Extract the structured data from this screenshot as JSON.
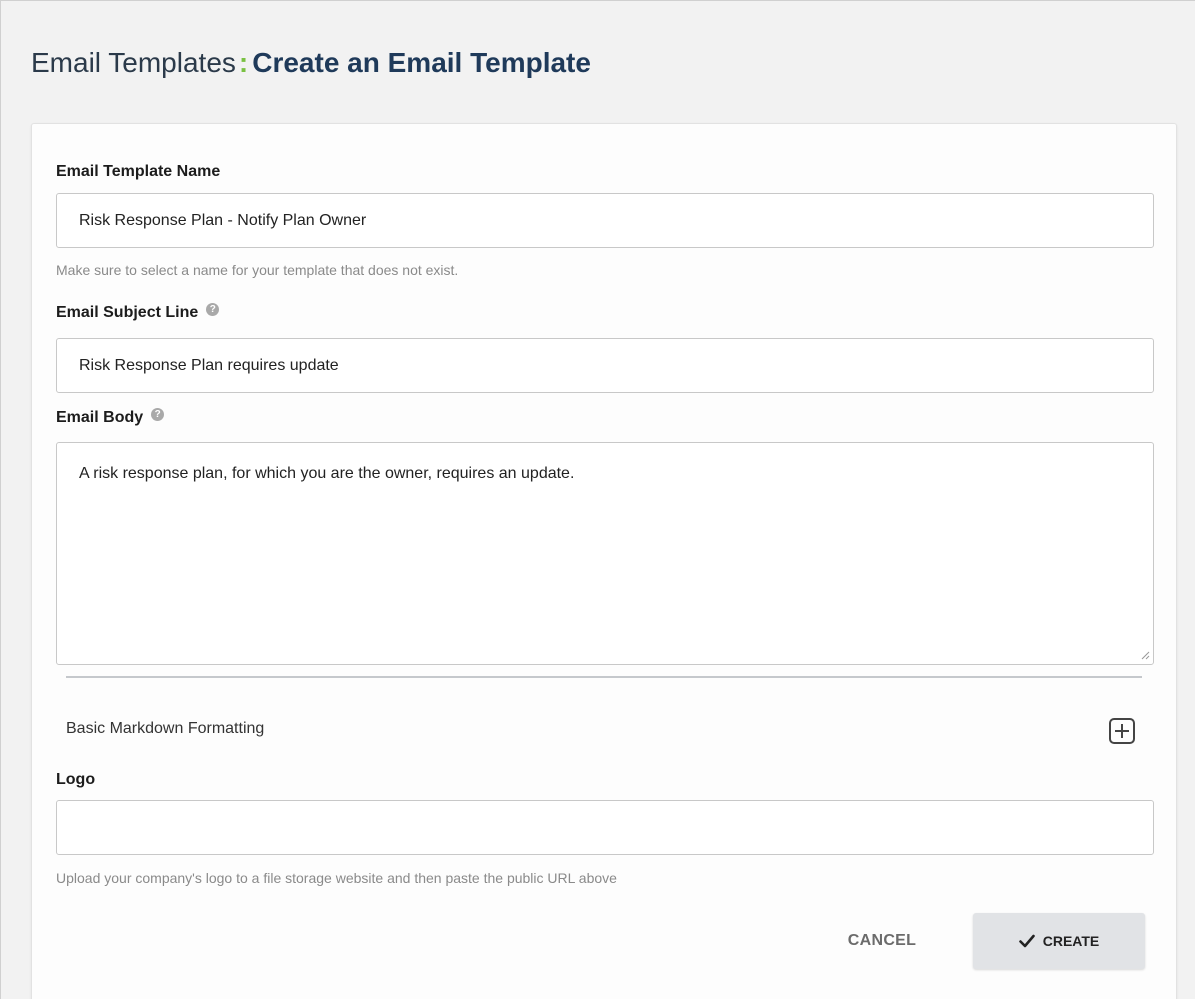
{
  "header": {
    "section": "Email Templates",
    "separator": ":",
    "page_title": "Create an Email Template"
  },
  "form": {
    "template_name": {
      "label": "Email Template Name",
      "value": "Risk Response Plan - Notify Plan Owner",
      "hint": "Make sure to select a name for your template that does not exist."
    },
    "subject_line": {
      "label": "Email Subject Line",
      "value": "Risk Response Plan requires update",
      "help_icon": "question-circle-icon"
    },
    "body": {
      "label": "Email Body",
      "value": "A risk response plan, for which you are the owner, requires an update.",
      "help_icon": "question-circle-icon"
    },
    "markdown": {
      "label": "Basic Markdown Formatting",
      "expand_icon": "plus-square-icon"
    },
    "logo": {
      "label": "Logo",
      "value": "",
      "hint": "Upload your company's logo to a file storage website and then paste the public URL above"
    }
  },
  "actions": {
    "cancel_label": "CANCEL",
    "create_label": "CREATE",
    "create_icon": "checkmark-icon"
  },
  "colors": {
    "accent_green": "#7ac143",
    "title_navy": "#1f3a5a",
    "create_button_bg": "#e1e3e6"
  }
}
